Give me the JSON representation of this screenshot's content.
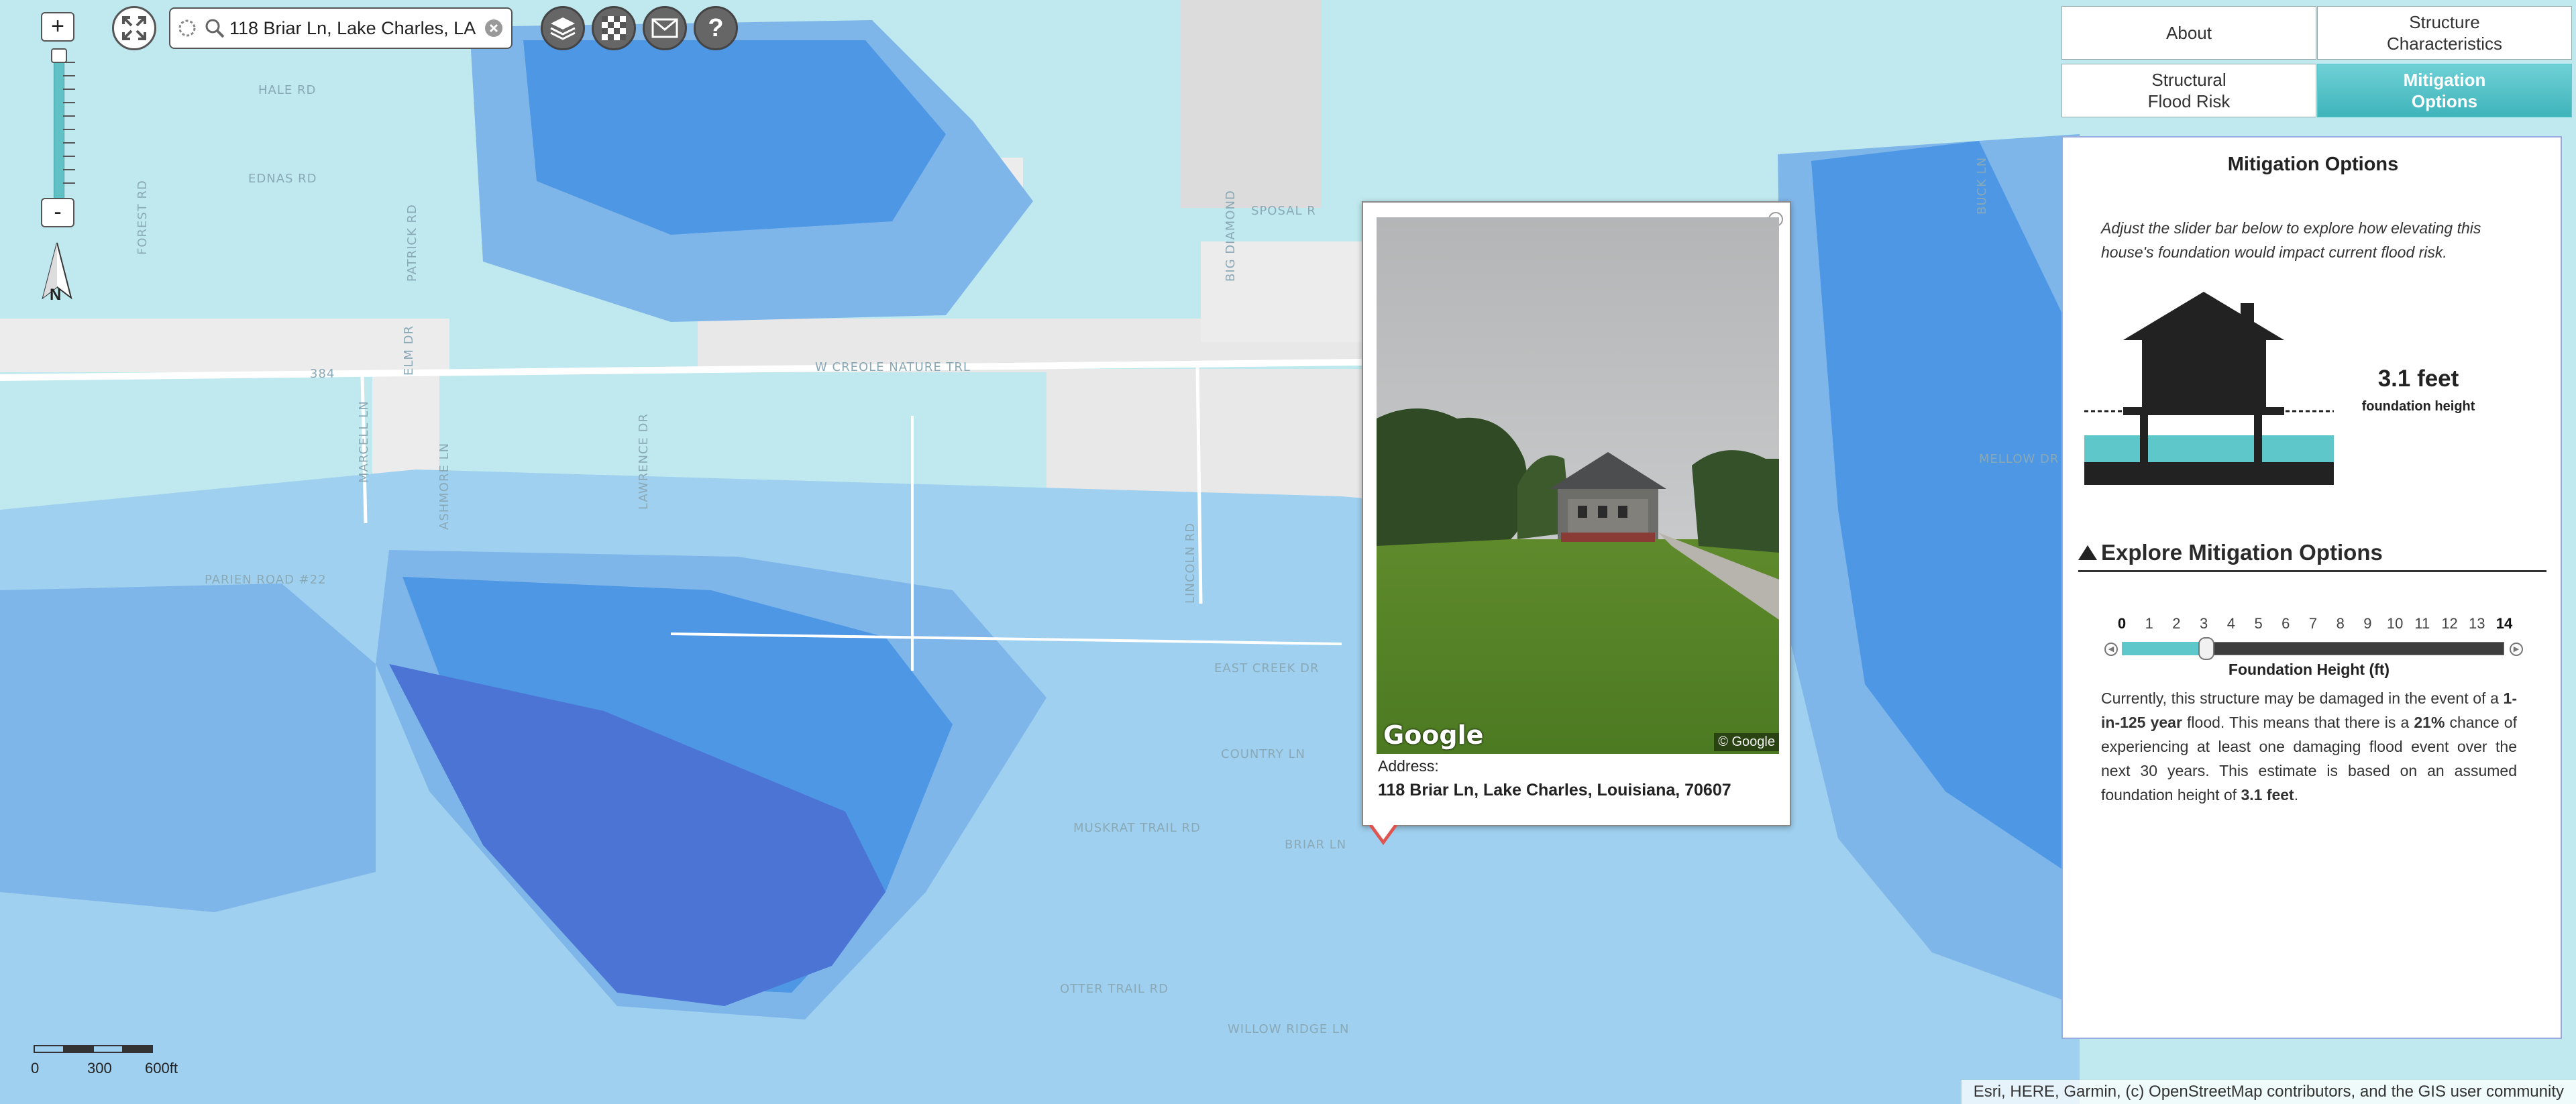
{
  "map": {
    "search": {
      "value": "118 Briar Ln, Lake Charles, LA"
    },
    "zoom": {
      "in_label": "+",
      "out_label": "-",
      "level_fraction": 0.95
    },
    "north_label": "N",
    "road_labels": [
      "HALE RD",
      "EDNAS RD",
      "FOREST RD",
      "PATRICK RD",
      "SPOSAL R",
      "384",
      "ELM DR",
      "BIG DIAMOND",
      "W CREOLE NATURE TRL",
      "MARCELL LN",
      "LAWRENCE DR",
      "ASHMORE LN",
      "PARIEN ROAD #22",
      "LINCOLN RD",
      "EAST CREEK DR",
      "COUNTRY LN",
      "MUSKRAT TRAIL RD",
      "BRIAR LN",
      "OTTER TRAIL RD",
      "WILLOW RIDGE LN",
      "BUCK LN",
      "MELLOW DR"
    ],
    "scalebar": {
      "labels": [
        "0",
        "300",
        "600ft"
      ]
    },
    "attribution": "Esri, HERE, Garmin, (c) OpenStreetMap contributors, and the GIS user community",
    "colors": {
      "low_risk": "#bfe9ee",
      "medium_risk": "#9fd0ef",
      "high_risk": "#7fb6ea",
      "higher_risk": "#4d97e4",
      "highest_risk": "#4b74d4",
      "land": "#ececec"
    }
  },
  "toolbar": {
    "icons": [
      "fullscreen-icon",
      "layers-icon",
      "basemap-icon",
      "mail-icon",
      "help-icon"
    ],
    "help_label": "?"
  },
  "popup": {
    "close_label": "×",
    "photo_brand": "Google",
    "photo_copyright": "© Google",
    "address_label": "Address:",
    "address": "118 Briar Ln, Lake Charles, Louisiana, 70607"
  },
  "tabs": [
    {
      "label": "About",
      "active": false
    },
    {
      "label": "Structure\nCharacteristics",
      "active": false
    },
    {
      "label": "Structural\nFlood Risk",
      "active": false
    },
    {
      "label": "Mitigation\nOptions",
      "active": true
    }
  ],
  "panel": {
    "title": "Mitigation Options",
    "intro": "Adjust the slider bar below to explore how elevating this house's foundation would impact current flood risk.",
    "foundation_height": "3.1 feet",
    "foundation_height_label": "foundation height",
    "section_title": "Explore Mitigation Options",
    "slider": {
      "ticks": [
        "0",
        "1",
        "2",
        "3",
        "4",
        "5",
        "6",
        "7",
        "8",
        "9",
        "10",
        "11",
        "12",
        "13",
        "14"
      ],
      "min": 0,
      "max": 14,
      "value": 3.1,
      "label": "Foundation Height (ft)"
    },
    "desc": {
      "p1": "Currently, this structure may be damaged in the event of a ",
      "b1": "1-in-125 year",
      "p2": " flood. This means that there is a ",
      "b2": "21%",
      "p3": " chance of experiencing at least one damaging flood event over the next 30 years. This estimate is based on an assumed foundation height of ",
      "b3": "3.1 feet",
      "p4": "."
    }
  }
}
